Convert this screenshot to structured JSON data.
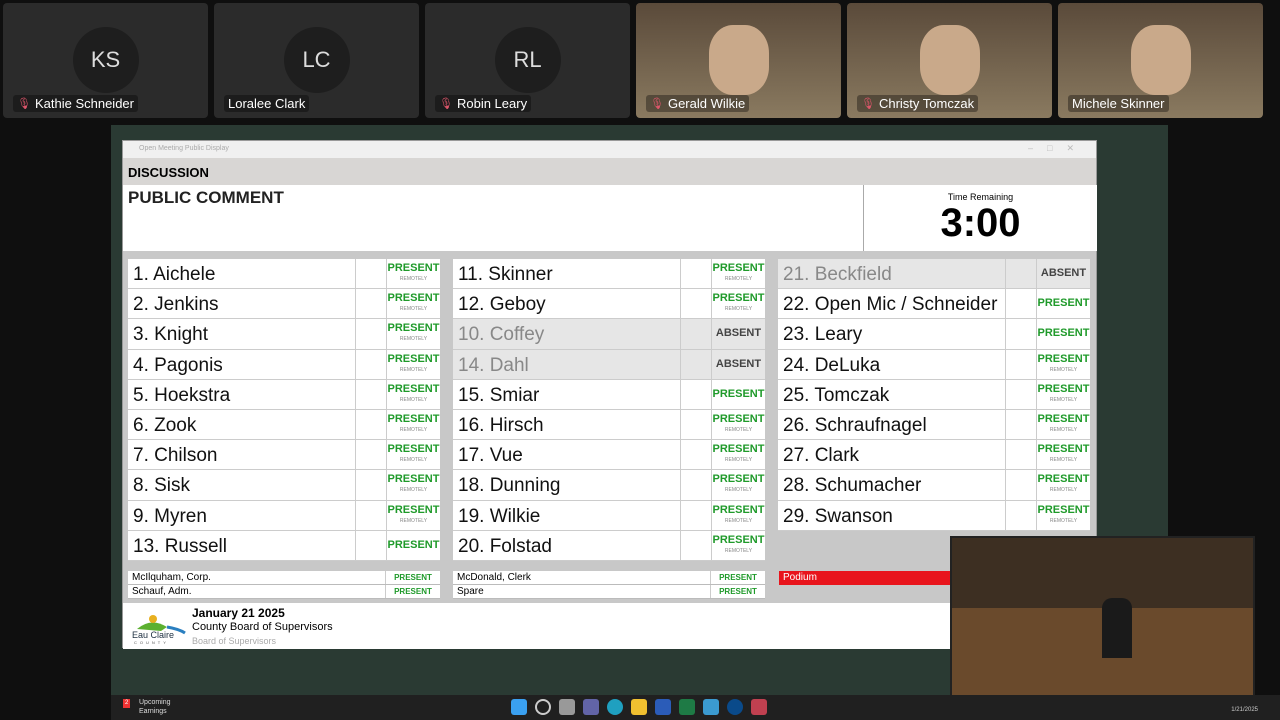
{
  "participants": [
    {
      "initials": "KS",
      "name": "Kathie Schneider",
      "muted": true
    },
    {
      "initials": "LC",
      "name": "Loralee Clark",
      "muted": false
    },
    {
      "initials": "RL",
      "name": "Robin Leary",
      "muted": true
    },
    {
      "initials": "",
      "name": "Gerald Wilkie",
      "muted": true
    },
    {
      "initials": "",
      "name": "Christy Tomczak",
      "muted": true
    },
    {
      "initials": "",
      "name": "Michele Skinner",
      "muted": false
    }
  ],
  "window": {
    "title": "Open Meeting Public Display",
    "section": "DISCUSSION",
    "item": "PUBLIC COMMENT",
    "timer_label": "Time Remaining",
    "timer_value": "3:00"
  },
  "columns": [
    [
      {
        "name": "1. Aichele",
        "status": "PRESENT",
        "sub": "REMOTELY"
      },
      {
        "name": "2. Jenkins",
        "status": "PRESENT",
        "sub": "REMOTELY"
      },
      {
        "name": "3. Knight",
        "status": "PRESENT",
        "sub": "REMOTELY"
      },
      {
        "name": "4. Pagonis",
        "status": "PRESENT",
        "sub": "REMOTELY"
      },
      {
        "name": "5. Hoekstra",
        "status": "PRESENT",
        "sub": "REMOTELY"
      },
      {
        "name": "6. Zook",
        "status": "PRESENT",
        "sub": "REMOTELY"
      },
      {
        "name": "7. Chilson",
        "status": "PRESENT",
        "sub": "REMOTELY"
      },
      {
        "name": "8. Sisk",
        "status": "PRESENT",
        "sub": "REMOTELY"
      },
      {
        "name": "9. Myren",
        "status": "PRESENT",
        "sub": "REMOTELY"
      },
      {
        "name": "13. Russell",
        "status": "PRESENT",
        "sub": ""
      }
    ],
    [
      {
        "name": "11. Skinner",
        "status": "PRESENT",
        "sub": "REMOTELY"
      },
      {
        "name": "12. Geboy",
        "status": "PRESENT",
        "sub": "REMOTELY"
      },
      {
        "name": "10. Coffey",
        "status": "ABSENT",
        "sub": ""
      },
      {
        "name": "14. Dahl",
        "status": "ABSENT",
        "sub": ""
      },
      {
        "name": "15. Smiar",
        "status": "PRESENT",
        "sub": ""
      },
      {
        "name": "16. Hirsch",
        "status": "PRESENT",
        "sub": "REMOTELY"
      },
      {
        "name": "17. Vue",
        "status": "PRESENT",
        "sub": "REMOTELY"
      },
      {
        "name": "18. Dunning",
        "status": "PRESENT",
        "sub": "REMOTELY"
      },
      {
        "name": "19. Wilkie",
        "status": "PRESENT",
        "sub": "REMOTELY"
      },
      {
        "name": "20. Folstad",
        "status": "PRESENT",
        "sub": "REMOTELY"
      }
    ],
    [
      {
        "name": "21. Beckfield",
        "status": "ABSENT",
        "sub": ""
      },
      {
        "name": "22. Open Mic / Schneider",
        "status": "PRESENT",
        "sub": ""
      },
      {
        "name": "23. Leary",
        "status": "PRESENT",
        "sub": ""
      },
      {
        "name": "24. DeLuka",
        "status": "PRESENT",
        "sub": "REMOTELY"
      },
      {
        "name": "25. Tomczak",
        "status": "PRESENT",
        "sub": "REMOTELY"
      },
      {
        "name": "26. Schraufnagel",
        "status": "PRESENT",
        "sub": "REMOTELY"
      },
      {
        "name": "27. Clark",
        "status": "PRESENT",
        "sub": "REMOTELY"
      },
      {
        "name": "28. Schumacher",
        "status": "PRESENT",
        "sub": "REMOTELY"
      },
      {
        "name": "29. Swanson",
        "status": "PRESENT",
        "sub": "REMOTELY"
      }
    ]
  ],
  "staff": [
    [
      {
        "name": "McIlquham, Corp.",
        "status": "PRESENT"
      },
      {
        "name": "Schauf, Adm.",
        "status": "PRESENT"
      }
    ],
    [
      {
        "name": "McDonald, Clerk",
        "status": "PRESENT"
      },
      {
        "name": "Spare",
        "status": "PRESENT"
      }
    ]
  ],
  "podium": "Podium",
  "footer": {
    "logo_text": "Eau Claire COUNTY",
    "date": "January 21 2025",
    "body": "County Board of Supervisors",
    "sub": "Board of Supervisors"
  },
  "taskbar": {
    "widget_badge": "2",
    "widget_line1": "Upcoming",
    "widget_line2": "Earnings",
    "date": "1/21/2025"
  },
  "colors": {
    "present": "#1f9a2a",
    "podium": "#e8141c",
    "stage": "#2a3a33"
  }
}
